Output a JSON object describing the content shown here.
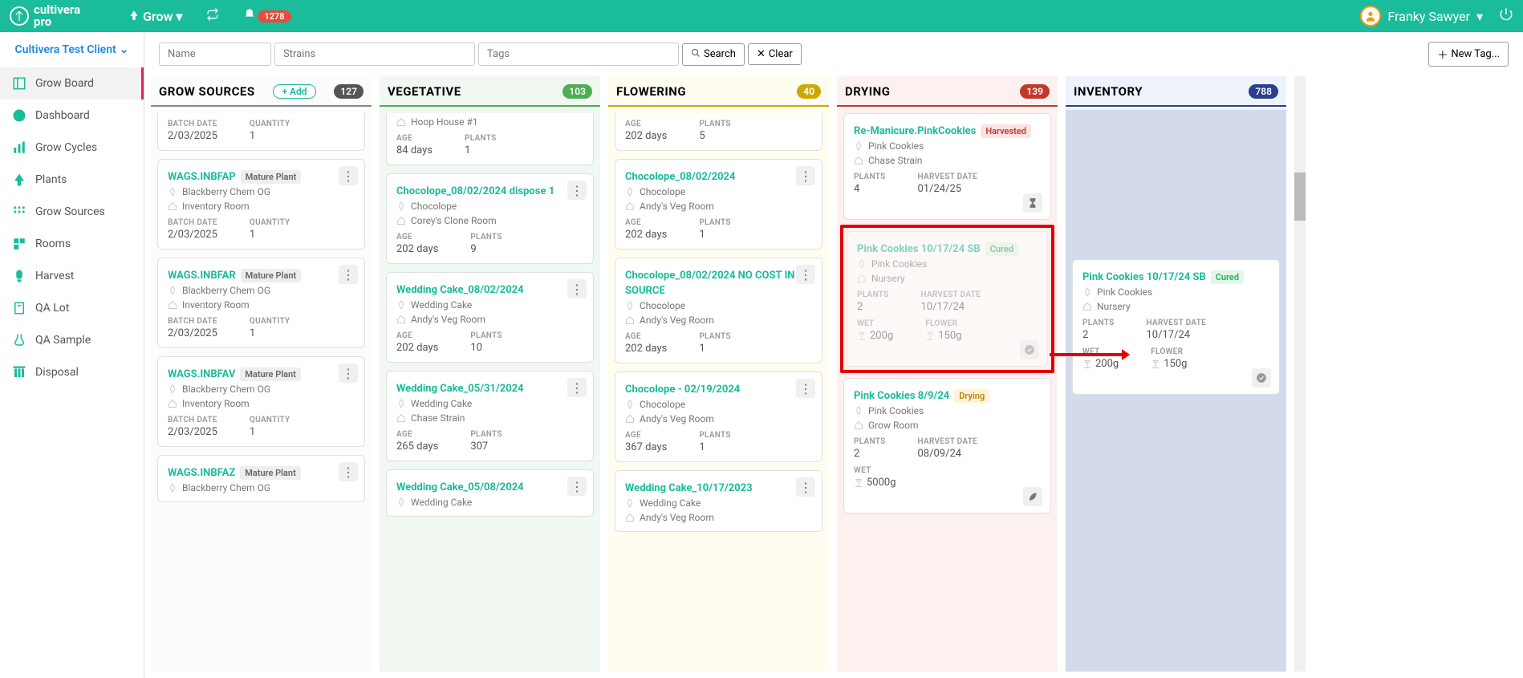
{
  "header": {
    "brand_top": "cultivera",
    "brand_sub": "pro",
    "nav_label": "Grow",
    "notif_count": "1278",
    "username": "Franky Sawyer"
  },
  "client": "Cultivera Test Client",
  "filters": {
    "name_ph": "Name",
    "strains_ph": "Strains",
    "tags_ph": "Tags",
    "search": "Search",
    "clear": "Clear",
    "newtag": "New Tag..."
  },
  "sidebar": {
    "items": [
      "Grow Board",
      "Dashboard",
      "Grow Cycles",
      "Plants",
      "Grow Sources",
      "Rooms",
      "Harvest",
      "QA Lot",
      "QA Sample",
      "Disposal"
    ]
  },
  "columns": {
    "sources": {
      "title": "GROW SOURCES",
      "add": "Add",
      "count": "127"
    },
    "veg": {
      "title": "VEGETATIVE",
      "count": "103"
    },
    "flower": {
      "title": "FLOWERING",
      "count": "40"
    },
    "drying": {
      "title": "DRYING",
      "count": "139"
    },
    "inventory": {
      "title": "INVENTORY",
      "count": "788"
    }
  },
  "labels": {
    "batchdate": "BATCH DATE",
    "quantity": "QUANTITY",
    "age": "AGE",
    "plants": "PLANTS",
    "harvestdate": "HARVEST DATE",
    "wet": "WET",
    "flower": "FLOWER"
  },
  "sources_cards": [
    {
      "title": "",
      "chip": "",
      "line1": "",
      "line2": "",
      "batch": "2/03/2025",
      "qty": "1"
    },
    {
      "title": "WAGS.INBFAP",
      "chip": "Mature Plant",
      "line1": "Blackberry Chem OG",
      "line2": "Inventory Room",
      "batch": "2/03/2025",
      "qty": "1"
    },
    {
      "title": "WAGS.INBFAR",
      "chip": "Mature Plant",
      "line1": "Blackberry Chem OG",
      "line2": "Inventory Room",
      "batch": "2/03/2025",
      "qty": "1"
    },
    {
      "title": "WAGS.INBFAV",
      "chip": "Mature Plant",
      "line1": "Blackberry Chem OG",
      "line2": "Inventory Room",
      "batch": "2/03/2025",
      "qty": "1"
    },
    {
      "title": "WAGS.INBFAZ",
      "chip": "Mature Plant",
      "line1": "Blackberry Chem OG",
      "line2": "",
      "batch": "",
      "qty": ""
    }
  ],
  "veg_cards": [
    {
      "title": "",
      "line1": "",
      "line2": "Hoop House #1",
      "age": "84 days",
      "plants": "1"
    },
    {
      "title": "Chocolope_08/02/2024 dispose 1",
      "line1": "Chocolope",
      "line2": "Corey's Clone Room",
      "age": "202 days",
      "plants": "9"
    },
    {
      "title": "Wedding Cake_08/02/2024",
      "line1": "Wedding Cake",
      "line2": "Andy's Veg Room",
      "age": "202 days",
      "plants": "10"
    },
    {
      "title": "Wedding Cake_05/31/2024",
      "line1": "Wedding Cake",
      "line2": "Chase Strain",
      "age": "265 days",
      "plants": "307"
    },
    {
      "title": "Wedding Cake_05/08/2024",
      "line1": "Wedding Cake",
      "line2": "",
      "age": "",
      "plants": ""
    }
  ],
  "flower_cards": [
    {
      "title": "",
      "line1": "",
      "line2": "",
      "age": "202 days",
      "plants": "5"
    },
    {
      "title": "Chocolope_08/02/2024",
      "line1": "Chocolope",
      "line2": "Andy's Veg Room",
      "age": "202 days",
      "plants": "1"
    },
    {
      "title": "Chocolope_08/02/2024 NO COST IN SOURCE",
      "line1": "Chocolope",
      "line2": "Andy's Veg Room",
      "age": "202 days",
      "plants": "1"
    },
    {
      "title": "Chocolope - 02/19/2024",
      "line1": "Chocolope",
      "line2": "Andy's Veg Room",
      "age": "367 days",
      "plants": "1"
    },
    {
      "title": "Wedding Cake_10/17/2023",
      "line1": "Wedding Cake",
      "line2": "Andy's Veg Room",
      "age": "",
      "plants": ""
    }
  ],
  "drying_cards": [
    {
      "title": "Re-Manicure.PinkCookies",
      "chip": "Harvested",
      "chipclass": "chip-harvested",
      "line1": "Pink Cookies",
      "line2": "Chase Strain",
      "plants": "4",
      "harvest": "01/24/25"
    },
    {
      "title": "Pink Cookies 10/17/24 SB",
      "chip": "Cured",
      "chipclass": "chip-cured",
      "line1": "Pink Cookies",
      "line2": "Nursery",
      "plants": "2",
      "harvest": "10/17/24",
      "wet": "200g",
      "flower": "150g",
      "highlight": true
    },
    {
      "title": "Pink Cookies 8/9/24",
      "chip": "Drying",
      "chipclass": "chip-drying",
      "line1": "Pink Cookies",
      "line2": "Grow Room",
      "plants": "2",
      "harvest": "08/09/24",
      "wet": "5000g"
    }
  ],
  "inventory_cards": [
    {
      "title": "Pink Cookies 10/17/24 SB",
      "chip": "Cured",
      "chipclass": "chip-cured",
      "line1": "Pink Cookies",
      "line2": "Nursery",
      "plants": "2",
      "harvest": "10/17/24",
      "wet": "200g",
      "flower": "150g"
    }
  ]
}
